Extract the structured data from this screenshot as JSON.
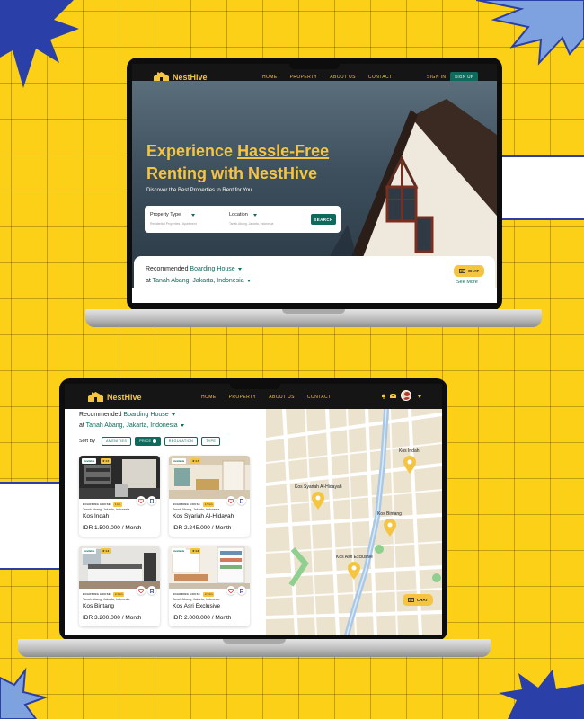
{
  "colors": {
    "background": "#FDD018",
    "accent": "#F5C542",
    "primary": "#0E6B5C",
    "dark": "#151515",
    "star": "#2B3FA8",
    "star_light": "#7EA2E0"
  },
  "laptop1": {
    "brand": "NestHive",
    "nav": [
      "HOME",
      "PROPERTY",
      "ABOUT US",
      "CONTACT"
    ],
    "signin": "SIGN IN",
    "signup": "SIGN UP",
    "hero": {
      "title_part1": "Experience ",
      "title_highlight": "Hassle-Free",
      "title_line2": "Renting with NestHive",
      "subtitle": "Discover the Best Properties to Rent for You"
    },
    "search": {
      "property_label": "Property Type",
      "property_hint": "Residential Properties - Apartment",
      "location_label": "Location",
      "location_hint": "Tanah Abang, Jakarta, Indonesia",
      "button": "SEARCH"
    },
    "rec": {
      "prefix": "Recommended ",
      "type": "Boarding House",
      "at": "at ",
      "location": "Tanah Abang, Jakarta, Indonesia"
    },
    "chat": "CHAT",
    "see_more": "See More"
  },
  "laptop2": {
    "brand": "NestHive",
    "nav": [
      "HOME",
      "PROPERTY",
      "ABOUT US",
      "CONTACT"
    ],
    "rec": {
      "prefix": "Recommended ",
      "type": "Boarding House",
      "at": "at ",
      "location": "Tanah Abang, Jakarta, Indonesia"
    },
    "sort_by": "Sort By",
    "sort_options": [
      "AMENITIES",
      "PRICE",
      "REGULATION",
      "TYPE"
    ],
    "cards": [
      {
        "badge": "Available",
        "rating": "★ 4.5",
        "type": "BOARDING HOUSE",
        "tag": "1 km",
        "location": "Tanah Abang, Jakarta, Indonesia",
        "name": "Kos Indah",
        "price": "IDR 1.500.000 / Month"
      },
      {
        "badge": "Available",
        "rating": "★ 4.7",
        "type": "BOARDING HOUSE",
        "tag": "1.5 km",
        "location": "Tanah Abang, Jakarta, Indonesia",
        "name": "Kos Syariah Al-Hidayah",
        "price": "IDR 2.245.000 / Month"
      },
      {
        "badge": "Available",
        "rating": "★ 4.3",
        "type": "BOARDING HOUSE",
        "tag": "2.1 km",
        "location": "Tanah Abang, Jakarta, Indonesia",
        "name": "Kos Bintang",
        "price": "IDR 3.200.000 / Month"
      },
      {
        "badge": "Available",
        "rating": "★ 4.6",
        "type": "BOARDING HOUSE",
        "tag": "2.3 km",
        "location": "Tanah Abang, Jakarta, Indonesia",
        "name": "Kos Asri Exclusive",
        "price": "IDR 2.000.000 / Month"
      }
    ],
    "map_pins": [
      "Kos Indah",
      "Kos Syariah Al-Hidayah",
      "Kos Bintang",
      "Kos Asri Exclusive"
    ],
    "chat": "CHAT"
  }
}
